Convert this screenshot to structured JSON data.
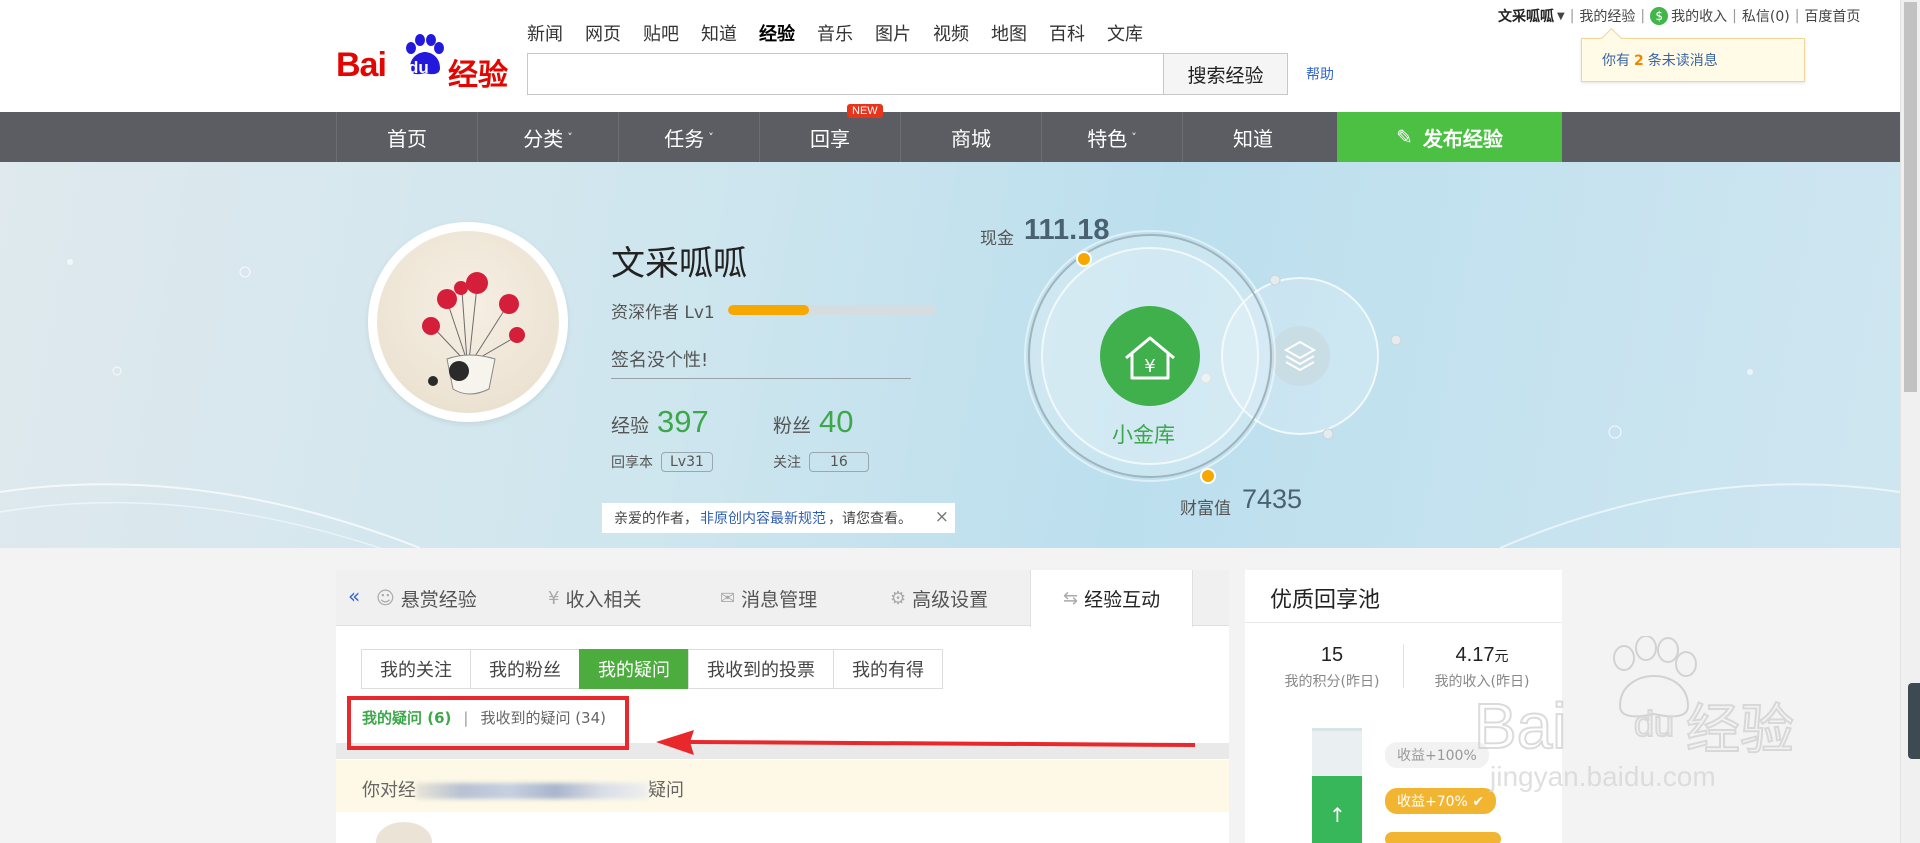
{
  "header": {
    "nav": [
      "新闻",
      "网页",
      "贴吧",
      "知道",
      "经验",
      "音乐",
      "图片",
      "视频",
      "地图",
      "百科",
      "文库"
    ],
    "nav_active": "经验",
    "search_button": "搜索经验",
    "search_value": "",
    "help": "帮助",
    "logo_text": "Baidu经验"
  },
  "userbar": {
    "username": "文采呱呱",
    "my_exp": "我的经验",
    "my_income": "我的收入",
    "messages": "私信(0)",
    "home": "百度首页",
    "coin_icon": "$"
  },
  "notice": {
    "prefix": "你有",
    "count": "2",
    "suffix": "条未读消息"
  },
  "mainnav": {
    "items": [
      {
        "label": "首页",
        "caret": ""
      },
      {
        "label": "分类",
        "caret": "˅"
      },
      {
        "label": "任务",
        "caret": "˅"
      },
      {
        "label": "回享",
        "caret": ""
      },
      {
        "label": "商城",
        "caret": ""
      },
      {
        "label": "特色",
        "caret": "˅"
      },
      {
        "label": "知道",
        "caret": ""
      }
    ],
    "new_badge": "NEW",
    "publish": "发布经验"
  },
  "profile": {
    "name": "文采呱呱",
    "level": "资深作者 Lv1",
    "level_progress": 0.39,
    "signature": "签名没个性!",
    "exp_label": "经验",
    "exp_value": "397",
    "fans_label": "粉丝",
    "fans_value": "40",
    "huixiang_label": "回享本",
    "huixiang_value": "Lv31",
    "follow_label": "关注",
    "follow_value": "16",
    "tip_prefix": "亲爱的作者，",
    "tip_link": "非原创内容最新规范",
    "tip_suffix": "，请您查看。",
    "tip_close": "×"
  },
  "vault": {
    "cash_label": "现金",
    "cash_value": "111.18",
    "name": "小金库",
    "wealth_label": "财富值",
    "wealth_value": "7435"
  },
  "tabs": {
    "collapse": "«",
    "items": [
      {
        "label": "悬赏经验",
        "icon": "☺"
      },
      {
        "label": "收入相关",
        "icon": "¥"
      },
      {
        "label": "消息管理",
        "icon": "✉"
      },
      {
        "label": "高级设置",
        "icon": "⚙"
      },
      {
        "label": "经验互动",
        "icon": "⇆"
      }
    ]
  },
  "subtabs": [
    "我的关注",
    "我的粉丝",
    "我的疑问",
    "我收到的投票",
    "我的有得"
  ],
  "subtab_active": "我的疑问",
  "filter": {
    "mine": "我的疑问 (6)",
    "separator": "|",
    "received": "我收到的疑问 (34)"
  },
  "question_row": {
    "prefix": "你对经",
    "suffix": "疑问"
  },
  "pool": {
    "title": "优质回享池",
    "score_value": "15",
    "score_label": "我的积分(昨日)",
    "income_value": "4.17",
    "income_unit": "元",
    "income_label": "我的收入(昨日)",
    "tag_100": "收益+100%",
    "tag_70": "收益+70%",
    "water_level": 0.6,
    "up_arrow": "↑",
    "check": "✔"
  },
  "watermark": {
    "brand": "Baidu经验",
    "url": "jingyan.baidu.com"
  },
  "colors": {
    "brand_red": "#e10601",
    "nav_gray": "#5c5c63",
    "green": "#4cc043",
    "accent_green": "#3da84a",
    "link_blue": "#3366cc",
    "annotation_red": "#e8282b",
    "gold": "#f6a800"
  }
}
